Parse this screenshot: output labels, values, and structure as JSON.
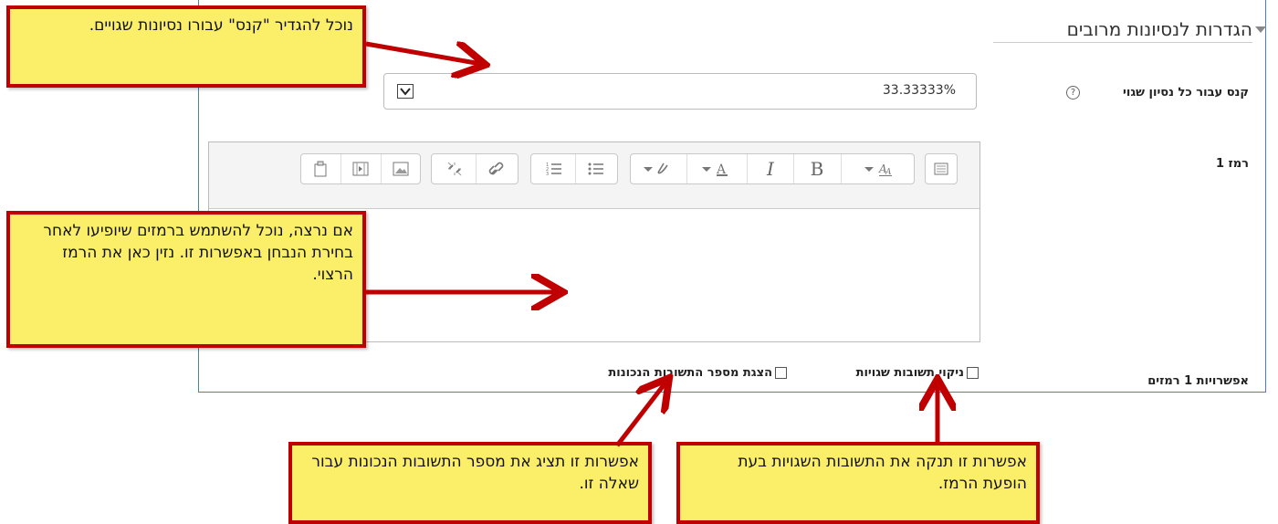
{
  "section": {
    "title": "הגדרות לנסיונות מרובים"
  },
  "penalty": {
    "label": "קנס עבור כל נסיון שגוי",
    "value": "33.33333%"
  },
  "hint": {
    "label": "רמז 1"
  },
  "hint_options": {
    "label": "אפשרויות 1 רמזים",
    "clear_wrong": "ניקוי תשובות שגויות",
    "show_num_correct": "הצגת מספר התשובות הנכונות"
  },
  "toolbar": {
    "bold": "B",
    "italic": "I"
  },
  "callouts": {
    "penalty": "נוכל להגדיר \"קנס\" עבורו נסיונות שגויים.",
    "hint": "אם נרצה, נוכל להשתמש ברמזים שיופיעו לאחר בחירת הנבחן באפשרות זו. נזין כאן את הרמז הרצוי.",
    "show_correct": "אפשרות זו תציג את מספר התשובות הנכונות עבור שאלה זו.",
    "clear_wrong": "אפשרות זו תנקה את התשובות השגויות בעת הופעת הרמז."
  },
  "icons": {
    "collapse": "triangle-down-icon",
    "help": "question-circle-icon",
    "toolbar": [
      "toolbar-toggle-icon",
      "font-family-icon",
      "bold-icon",
      "italic-icon",
      "font-color-icon",
      "background-color-icon",
      "unordered-list-icon",
      "ordered-list-icon",
      "link-icon",
      "unlink-icon",
      "image-icon",
      "media-icon",
      "manage-files-icon"
    ]
  },
  "colors": {
    "callout_fill": "#fbef6a",
    "callout_border": "#c00000",
    "arrow": "#c00000",
    "frame": "#4a7ebf"
  }
}
